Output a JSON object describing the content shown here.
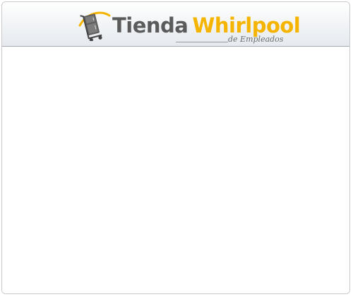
{
  "header": {
    "logo": {
      "brand_part1": "Tienda",
      "brand_part2": "Whirlpool",
      "tagline": "de Empleados",
      "icon": "appliance-cart-icon",
      "colors": {
        "gray": "#5b5b5b",
        "accent": "#f5b400"
      }
    }
  },
  "main": {
    "content": ""
  }
}
